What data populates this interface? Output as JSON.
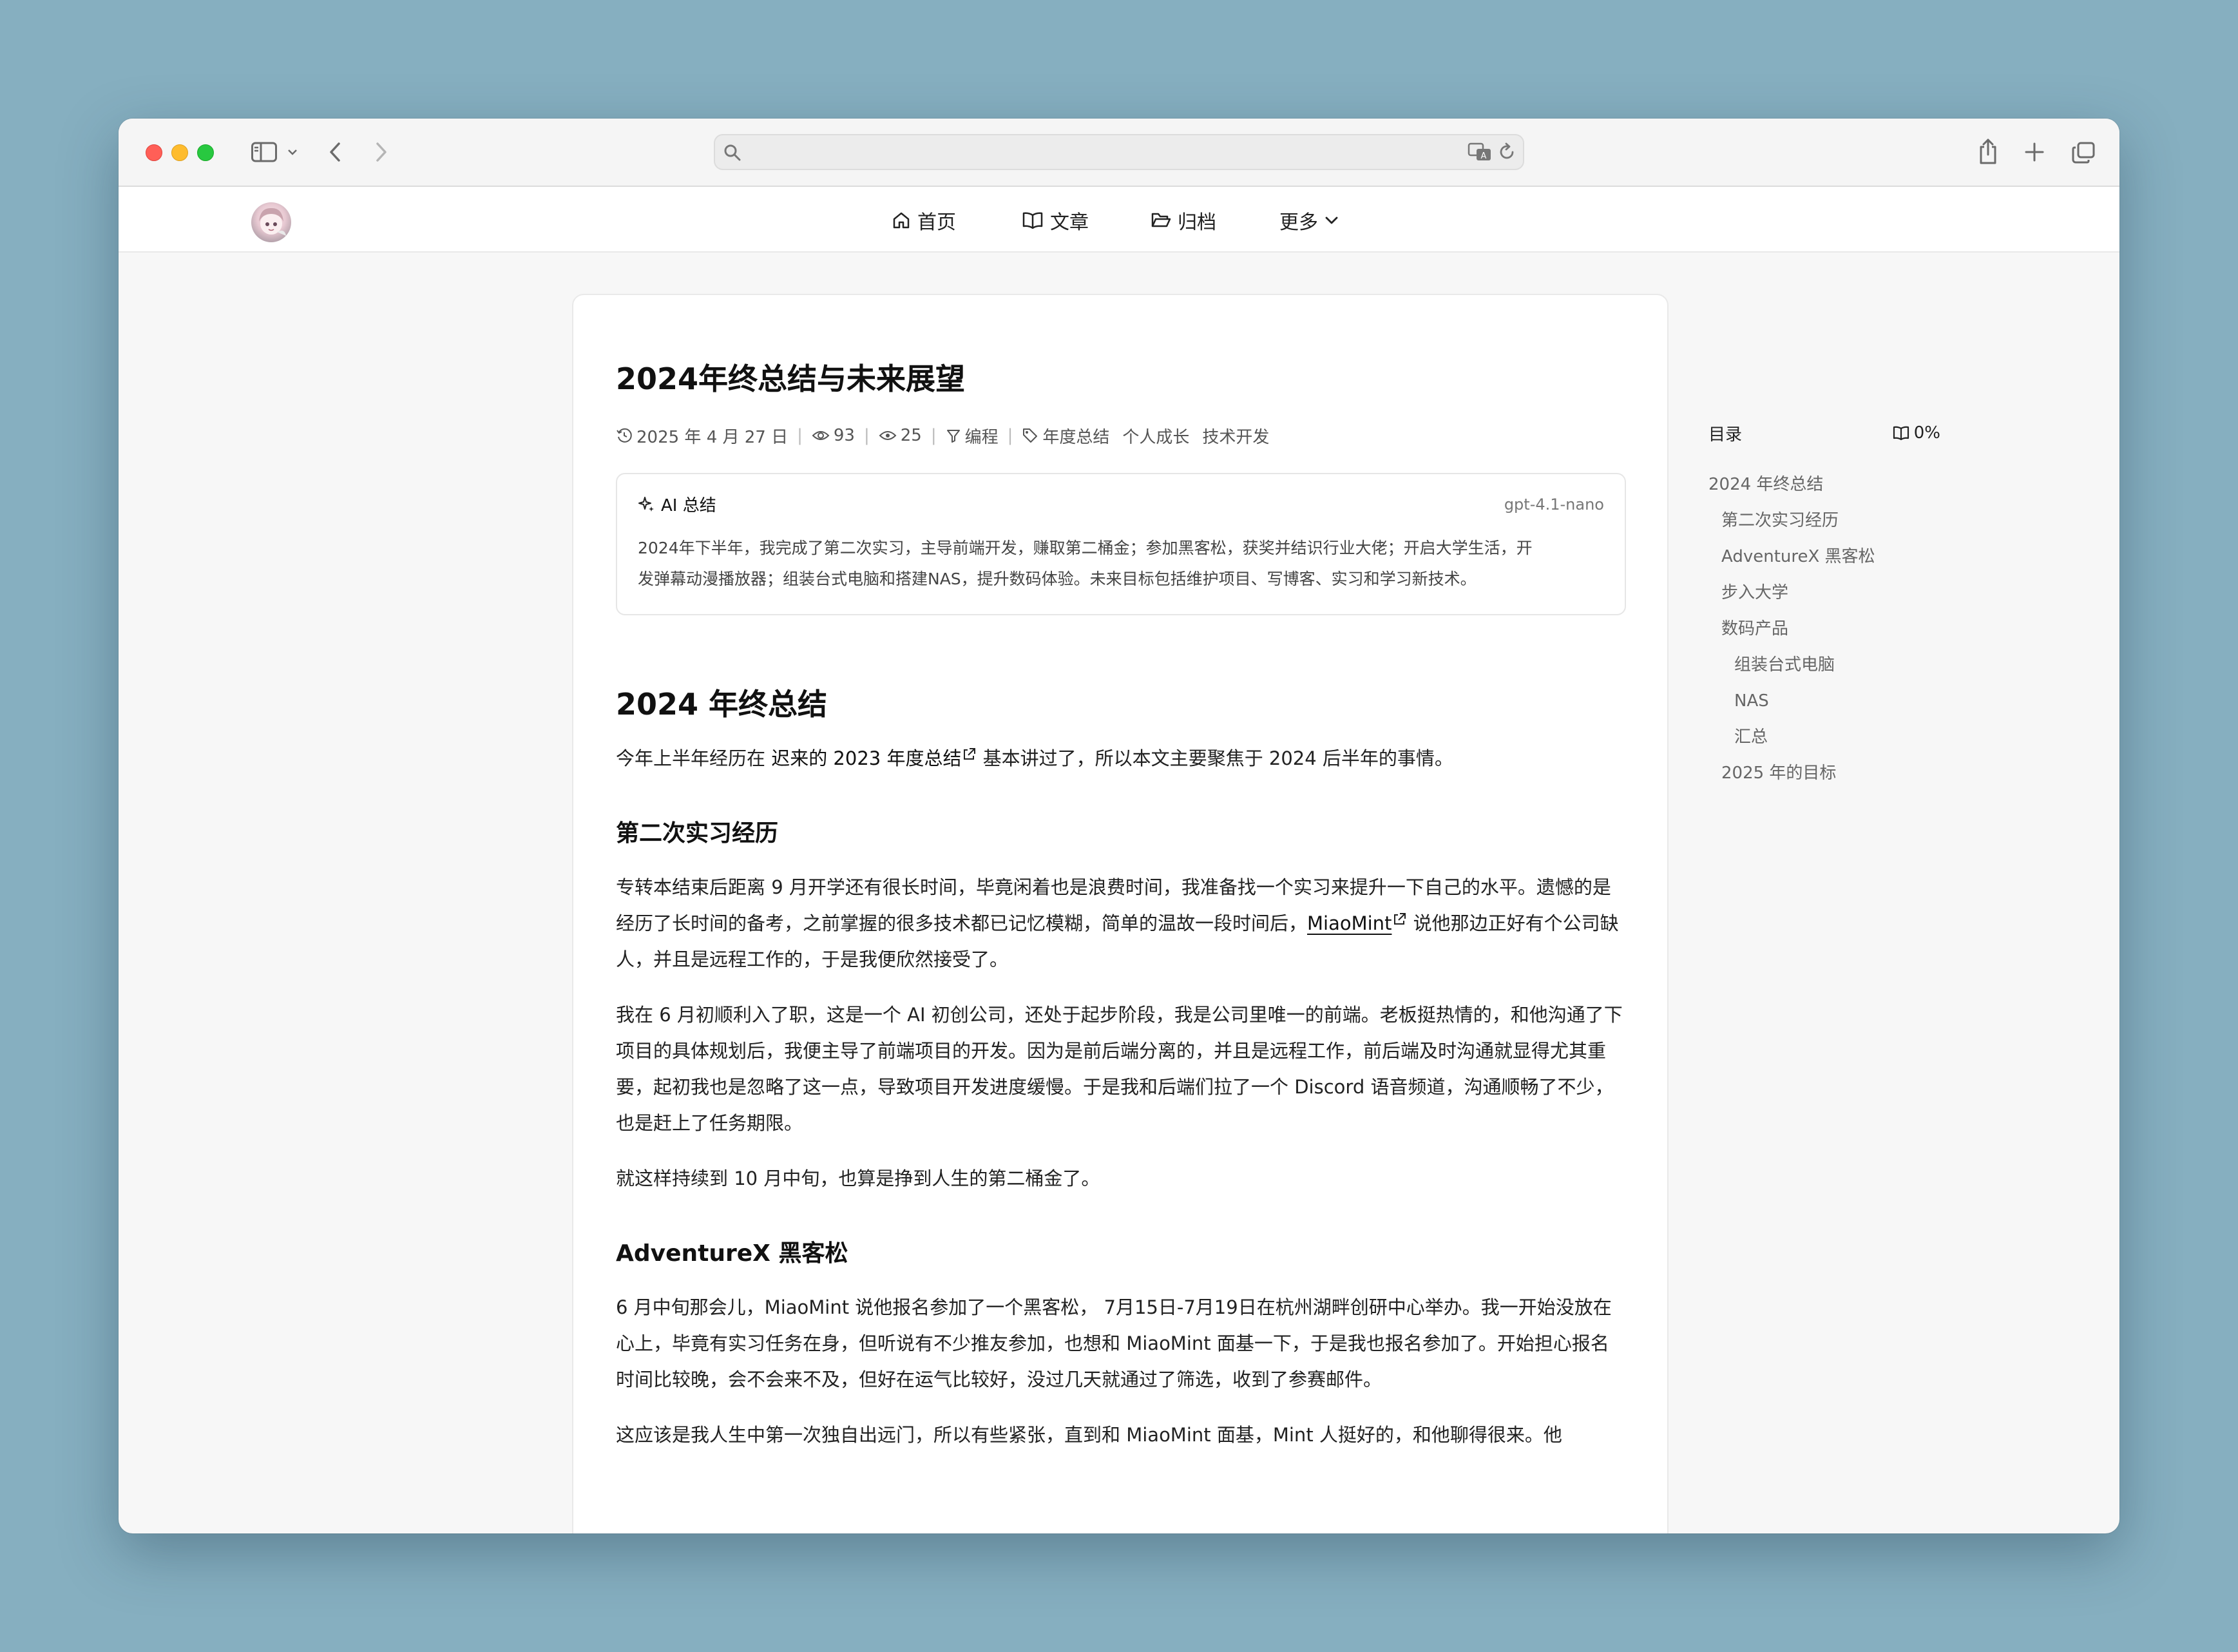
{
  "nav": {
    "home": "首页",
    "articles": "文章",
    "archive": "归档",
    "more": "更多"
  },
  "article": {
    "title": "2024年终总结与未来展望",
    "meta": {
      "date": "2025 年 4 月 27 日",
      "views": "93",
      "comments": "25",
      "category": "编程",
      "tags": [
        "年度总结",
        "个人成长",
        "技术开发"
      ]
    },
    "ai_summary": {
      "title": "AI 总结",
      "model": "gpt-4.1-nano",
      "line1": "2024年下半年，我完成了第二次实习，主导前端开发，赚取第二桶金；参加黑客松，获奖并结识行业大佬；开启大学生活，开",
      "line2": "发弹幕动漫播放器；组装台式电脑和搭建NAS，提升数码体验。未来目标包括维护项目、写博客、实习和学习新技术。"
    },
    "h2_1": "2024 年终总结",
    "p_intro": {
      "pre": "今年上半年经历在 ",
      "link": "迟来的 2023 年度总结",
      "post": " 基本讲过了，所以本文主要聚焦于 2024 后半年的事情。"
    },
    "h3_1": "第二次实习经历",
    "p1": {
      "pre": "专转本结束后距离 9 月开学还有很长时间，毕竟闲着也是浪费时间，我准备找一个实习来提升一下自己的水平。遗憾的是经历了长时间的备考，之前掌握的很多技术都已记忆模糊，简单的温故一段时间后，",
      "link": "MiaoMint",
      "post": " 说他那边正好有个公司缺人，并且是远程工作的，于是我便欣然接受了。"
    },
    "p2": "我在 6 月初顺利入了职，这是一个 AI 初创公司，还处于起步阶段，我是公司里唯一的前端。老板挺热情的，和他沟通了下项目的具体规划后，我便主导了前端项目的开发。因为是前后端分离的，并且是远程工作，前后端及时沟通就显得尤其重要，起初我也是忽略了这一点，导致项目开发进度缓慢。于是我和后端们拉了一个 Discord 语音频道，沟通顺畅了不少，也是赶上了任务期限。",
    "p3": "就这样持续到 10 月中旬，也算是挣到人生的第二桶金了。",
    "h3_2": "AdventureX 黑客松",
    "p4": "6 月中旬那会儿，MiaoMint 说他报名参加了一个黑客松， 7月15日-7月19日在杭州湖畔创研中心举办。我一开始没放在心上，毕竟有实习任务在身，但听说有不少推友参加，也想和 MiaoMint 面基一下，于是我也报名参加了。开始担心报名时间比较晚，会不会来不及，但好在运气比较好，没过几天就通过了筛选，收到了参赛邮件。",
    "p5": "这应该是我人生中第一次独自出远门，所以有些紧张，直到和 MiaoMint 面基，Mint 人挺好的，和他聊得很来。他"
  },
  "toc": {
    "title": "目录",
    "progress": "0%",
    "items": [
      {
        "label": "2024 年终总结",
        "level": 1
      },
      {
        "label": "第二次实习经历",
        "level": 2
      },
      {
        "label": "AdventureX 黑客松",
        "level": 2
      },
      {
        "label": "步入大学",
        "level": 2
      },
      {
        "label": "数码产品",
        "level": 2
      },
      {
        "label": "组装台式电脑",
        "level": 3
      },
      {
        "label": "NAS",
        "level": 3
      },
      {
        "label": "汇总",
        "level": 3
      },
      {
        "label": "2025 年的目标",
        "level": 2
      }
    ]
  }
}
